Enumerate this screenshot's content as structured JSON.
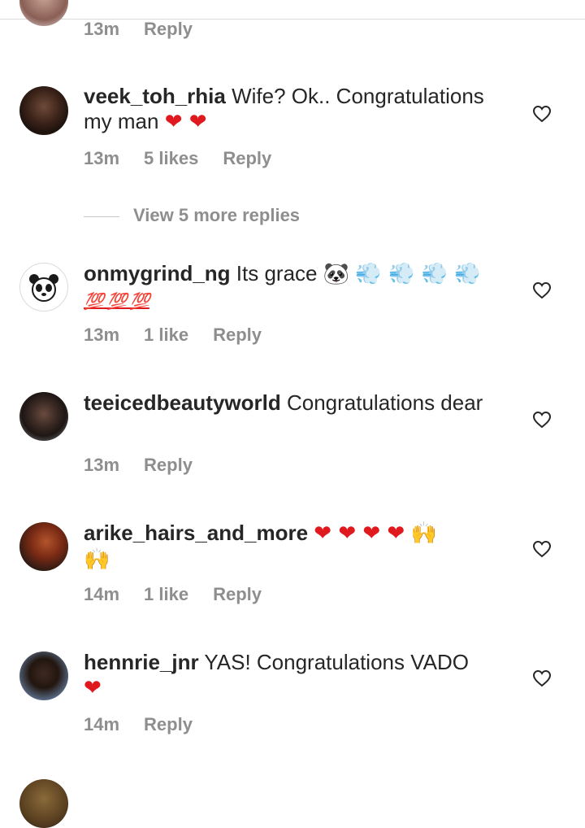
{
  "top_comment": {
    "time": "13m",
    "reply": "Reply"
  },
  "comments": [
    {
      "username": "veek_toh_rhia",
      "text": " Wife? Ok.. Congratulations my man ",
      "emoji": "❤ ❤",
      "time": "13m",
      "likes": "5 likes",
      "reply": "Reply"
    },
    {
      "username": "onmygrind_ng",
      "text": " Its grace ",
      "emoji1": "🐼",
      "emoji2": "💨 💨 💨 💨",
      "emoji3": "💯 💯 💯",
      "time": "13m",
      "likes": "1 like",
      "reply": "Reply"
    },
    {
      "username": "teeicedbeautyworld",
      "text": " Congratulations dear",
      "time": "13m",
      "reply": "Reply"
    },
    {
      "username": "arike_hairs_and_more",
      "emoji": "❤ ❤ ❤ ❤",
      "emoji2": "🙌",
      "emoji3": "🙌",
      "time": "14m",
      "likes": "1 like",
      "reply": "Reply"
    },
    {
      "username": "hennrie_jnr",
      "text": " YAS! Congratulations VADO",
      "emoji": "❤",
      "time": "14m",
      "reply": "Reply"
    }
  ],
  "view_more_replies": "View 5 more replies",
  "icons": {
    "like": "heart-outline-icon"
  },
  "colors": {
    "text": "#262626",
    "meta": "#8e8e8e",
    "heart_emoji": "#e0191f"
  }
}
